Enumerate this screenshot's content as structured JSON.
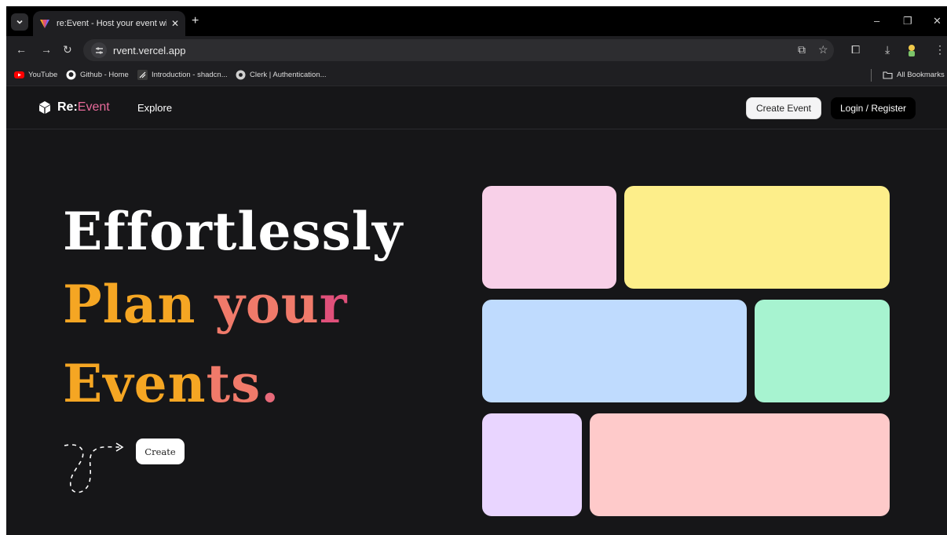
{
  "browser": {
    "tab_title": "re:Event - Host your event with re:",
    "tab_close": "✕",
    "new_tab": "+",
    "window_controls": {
      "minimize": "–",
      "restore": "❐",
      "close": "✕"
    },
    "url": "rvent.vercel.app",
    "bookmarks": [
      {
        "label": "YouTube",
        "icon": "youtube-icon"
      },
      {
        "label": "Github - Home",
        "icon": "github-icon"
      },
      {
        "label": "Introduction - shadcn...",
        "icon": "shadcn-icon"
      },
      {
        "label": "Clerk | Authentication...",
        "icon": "clerk-icon"
      }
    ],
    "all_bookmarks": "All Bookmarks"
  },
  "site": {
    "logo": {
      "brand_main": "Re:",
      "brand_accent": "Event"
    },
    "nav": {
      "explore": "Explore"
    },
    "header_buttons": {
      "create_event": "Create Event",
      "login": "Login / Register"
    }
  },
  "hero": {
    "line1": "Effortlessly",
    "line2_a": "Plan ",
    "line2_b": "you",
    "line2_c": "r",
    "line3_a": "Even",
    "line3_b": "ts",
    "line3_c": ".",
    "cta": "Create"
  },
  "colors": {
    "accent_orange": "#f5a623",
    "accent_pink": "#e0507a",
    "tile_pink": "#f8d0e8",
    "tile_yellow": "#fdee8a",
    "tile_blue": "#bfdbfe",
    "tile_green": "#a7f3d0",
    "tile_purple": "#e9d5ff",
    "tile_rose": "#fecaca"
  }
}
